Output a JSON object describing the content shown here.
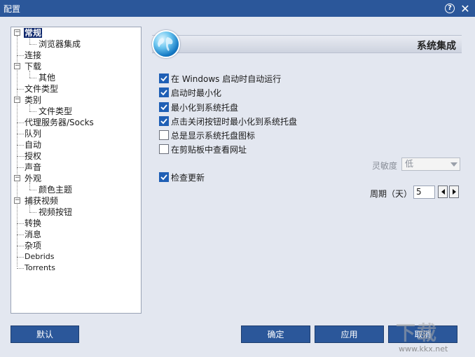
{
  "window": {
    "title": "配置"
  },
  "tree": {
    "items": [
      {
        "label": "常规",
        "selected": true,
        "expanded": true
      },
      {
        "label": "浏览器集成"
      },
      {
        "label": "连接"
      },
      {
        "label": "下载",
        "expanded": true
      },
      {
        "label": "其他"
      },
      {
        "label": "文件类型"
      },
      {
        "label": "类别",
        "expanded": true
      },
      {
        "label": "文件类型"
      },
      {
        "label": "代理服务器/Socks"
      },
      {
        "label": "队列"
      },
      {
        "label": "自动"
      },
      {
        "label": "授权"
      },
      {
        "label": "声音"
      },
      {
        "label": "外观",
        "expanded": true
      },
      {
        "label": "颜色主题"
      },
      {
        "label": "捕获视频",
        "expanded": true
      },
      {
        "label": "视频按钮"
      },
      {
        "label": "转换"
      },
      {
        "label": "消息"
      },
      {
        "label": "杂项"
      },
      {
        "label": "Debrids"
      },
      {
        "label": "Torrents"
      }
    ]
  },
  "panel": {
    "title": "系统集成",
    "options": [
      {
        "label": "在 Windows 启动时自动运行",
        "checked": true
      },
      {
        "label": "启动时最小化",
        "checked": true
      },
      {
        "label": "最小化到系统托盘",
        "checked": true
      },
      {
        "label": "点击关闭按钮时最小化到系统托盘",
        "checked": true
      },
      {
        "label": "总是显示系统托盘图标",
        "checked": false
      },
      {
        "label": "在剪贴板中查看网址",
        "checked": false
      }
    ],
    "sensitivity": {
      "label": "灵敏度",
      "value": "低"
    },
    "check_updates": {
      "label": "检查更新",
      "checked": true
    },
    "period": {
      "label": "周期（天）",
      "value": "5"
    }
  },
  "buttons": {
    "default": "默认",
    "ok": "确定",
    "apply": "应用",
    "cancel": "取消"
  },
  "watermark": {
    "text": "下载",
    "url": "www.kkx.net"
  },
  "colors": {
    "title_bar": "#2b579a",
    "button": "#2b579a",
    "check": "#1f5fb5",
    "background": "#e3e7f0"
  }
}
